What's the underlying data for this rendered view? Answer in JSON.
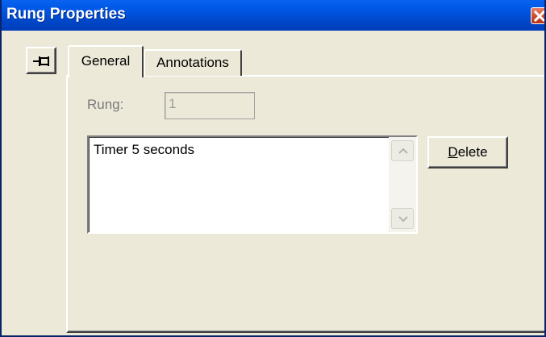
{
  "window": {
    "title": "Rung Properties",
    "close_icon": "close-icon"
  },
  "toolbar": {
    "pin_icon": "pin-icon"
  },
  "tabs": [
    {
      "label": "General",
      "active": true
    },
    {
      "label": "Annotations",
      "active": false
    }
  ],
  "general": {
    "rung_label": "Rung:",
    "rung_value": "1",
    "annotations": [
      "Timer 5 seconds"
    ],
    "delete_mnemonic": "D",
    "delete_rest": "elete"
  },
  "colors": {
    "titlebar": "#0058e6",
    "close": "#d24e2e",
    "dialog_bg": "#ece9d8"
  }
}
